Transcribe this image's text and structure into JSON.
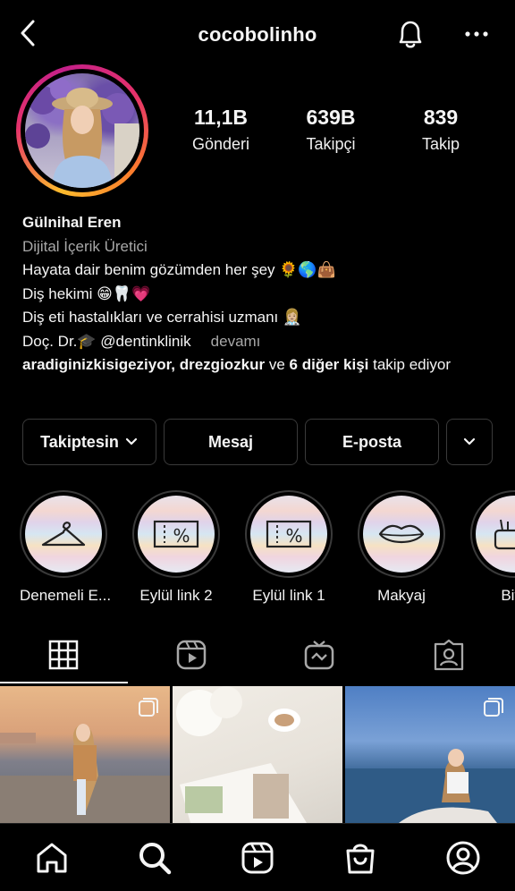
{
  "header": {
    "username": "cocobolinho",
    "back_icon": "back-chevron-icon",
    "bell_icon": "bell-icon",
    "more_icon": "more-dots-icon"
  },
  "profile": {
    "avatar": "profile-photo",
    "stats": [
      {
        "value": "11,1B",
        "label": "Gönderi"
      },
      {
        "value": "639B",
        "label": "Takipçi"
      },
      {
        "value": "839",
        "label": "Takip"
      }
    ]
  },
  "bio": {
    "name": "Gülnihal Eren",
    "category": "Dijital İçerik Üretici",
    "line1": "Hayata dair benim gözümden her şey 🌻🌎👜",
    "line2": "Diş hekimi 😁🦷💗",
    "line3": "Diş eti hastalıkları ve cerrahisi uzmanı 👩🏼‍⚕️",
    "line4_prefix": "Doç. Dr.🎓 @dentinklinik",
    "more": "devamı",
    "followers_a": "aradiginizkisigeziyor, drezgiozkur",
    "followers_mid": " ve ",
    "followers_b": "6 diğer kişi",
    "followers_end": " takip ediyor"
  },
  "actions": {
    "following": "Takiptesin",
    "message": "Mesaj",
    "email": "E-posta"
  },
  "highlights": [
    {
      "label": "Denemeli E...",
      "icon": "hanger-icon"
    },
    {
      "label": "Eylül link 2",
      "icon": "coupon-icon"
    },
    {
      "label": "Eylül link 1",
      "icon": "coupon-icon"
    },
    {
      "label": "Makyaj",
      "icon": "lips-icon"
    },
    {
      "label": "Bite",
      "icon": "makeup-bag-icon"
    }
  ],
  "tabs": [
    "grid-icon",
    "reels-icon",
    "igtv-icon",
    "tagged-icon"
  ],
  "bottom_nav": [
    "home-icon",
    "search-icon",
    "reels-icon",
    "shop-icon",
    "profile-icon"
  ],
  "colors": {
    "background": "#000000",
    "text": "#f5f5f5",
    "muted": "#a8a8a8",
    "border": "#3a3a3a"
  }
}
